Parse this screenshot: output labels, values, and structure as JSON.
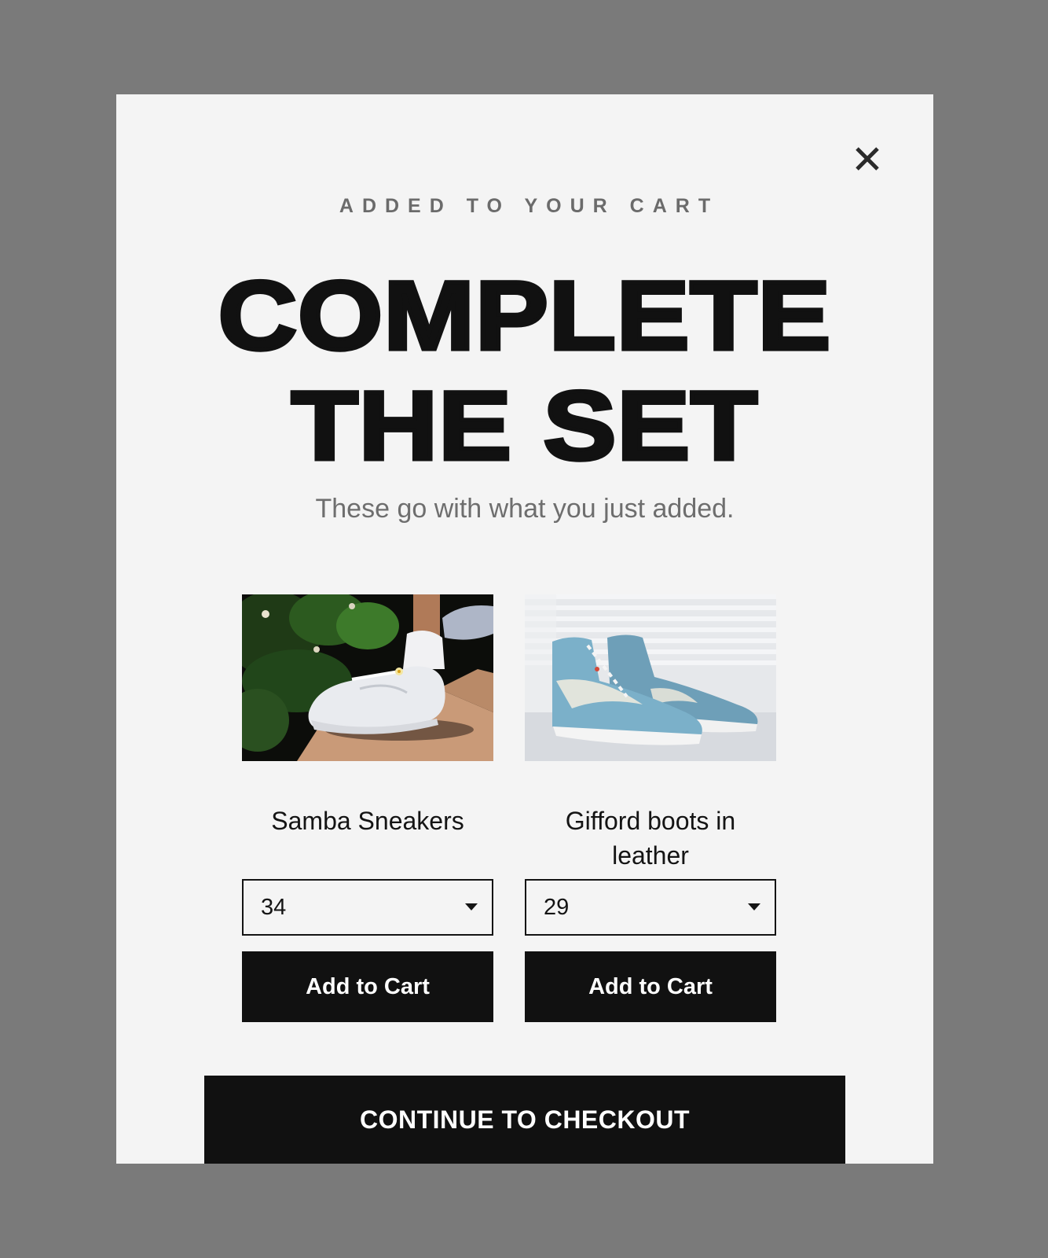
{
  "modal": {
    "eyebrow": "ADDED TO YOUR CART",
    "title_line1": "COMPLETE",
    "title_line2": "THE SET",
    "subtitle": "These go with what you just added.",
    "close_icon": "close-icon",
    "checkout_label": "CONTINUE TO CHECKOUT"
  },
  "products": [
    {
      "name": "Samba Sneakers",
      "size": "34",
      "add_label": "Add to Cart",
      "image": "white-sneaker-photo"
    },
    {
      "name": "Gifford boots in leather",
      "size": "29",
      "add_label": "Add to Cart",
      "image": "blue-high-top-sneakers-photo"
    }
  ],
  "colors": {
    "overlay": "#7a7a7a",
    "modal_bg": "#f4f4f4",
    "button_bg": "#111111",
    "button_text": "#ffffff",
    "muted_text": "#6e6e6e"
  }
}
